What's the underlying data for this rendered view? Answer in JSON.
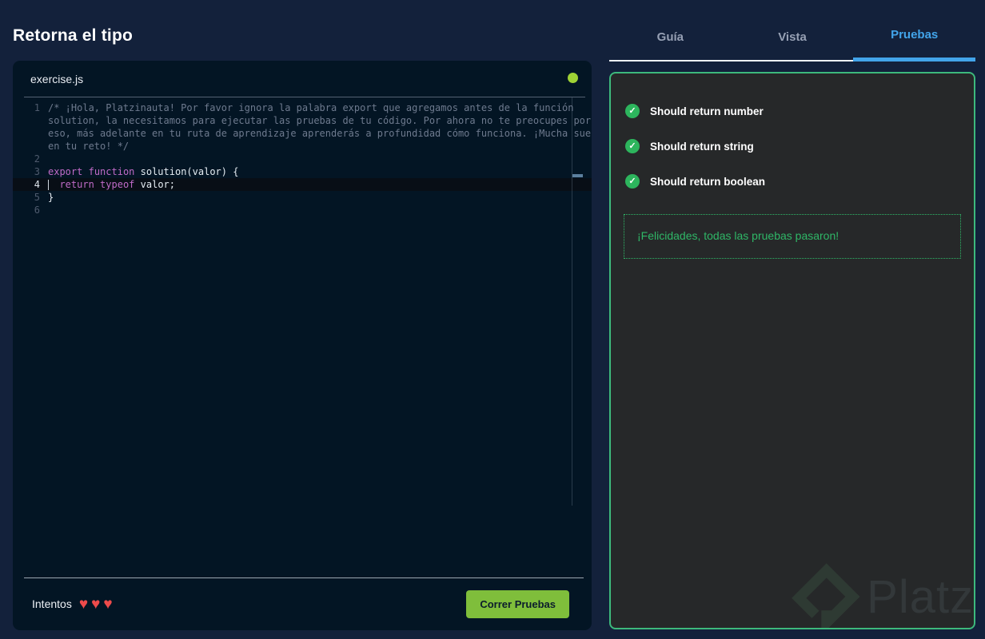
{
  "page": {
    "title": "Retorna el tipo"
  },
  "editor": {
    "filename": "exercise.js",
    "status_dot_color": "#9fd235",
    "rows": [
      {
        "gutter": "1",
        "tokens": [
          {
            "t": "/* ¡Hola, Platzinauta! Por favor ignora la palabra export que agregamos antes de la función",
            "c": "comment"
          }
        ]
      },
      {
        "gutter": "",
        "tokens": [
          {
            "t": "solution, la necesitamos para ejecutar las pruebas de tu código. Por ahora no te preocupes por",
            "c": "comment"
          }
        ]
      },
      {
        "gutter": "",
        "tokens": [
          {
            "t": "eso, más adelante en tu ruta de aprendizaje aprenderás a profundidad cómo funciona. ¡Mucha suerte",
            "c": "comment"
          }
        ]
      },
      {
        "gutter": "",
        "tokens": [
          {
            "t": "en tu reto! */",
            "c": "comment"
          }
        ]
      },
      {
        "gutter": "2",
        "tokens": []
      },
      {
        "gutter": "3",
        "tokens": [
          {
            "t": "export",
            "c": "keyword"
          },
          {
            "t": " ",
            "c": "plain"
          },
          {
            "t": "function",
            "c": "keyword"
          },
          {
            "t": " ",
            "c": "plain"
          },
          {
            "t": "solution(valor) {",
            "c": "plain"
          }
        ]
      },
      {
        "gutter": "4",
        "active": true,
        "cursor": true,
        "tokens": [
          {
            "t": "  ",
            "c": "plain"
          },
          {
            "t": "return",
            "c": "keyword"
          },
          {
            "t": " ",
            "c": "plain"
          },
          {
            "t": "typeof",
            "c": "keyword"
          },
          {
            "t": " ",
            "c": "plain"
          },
          {
            "t": "valor;",
            "c": "plain"
          }
        ]
      },
      {
        "gutter": "5",
        "tokens": [
          {
            "t": "}",
            "c": "plain"
          }
        ]
      },
      {
        "gutter": "6",
        "tokens": []
      }
    ],
    "footer": {
      "attempts_label": "Intentos",
      "hearts_count": 3,
      "heart_color": "#ee4b4b",
      "run_button_label": "Correr Pruebas",
      "run_button_color": "#7fbe3b"
    }
  },
  "tabs": [
    {
      "label": "Guía",
      "active": false
    },
    {
      "label": "Vista",
      "active": false
    },
    {
      "label": "Pruebas",
      "active": true
    }
  ],
  "tabs_accent_color": "#42a4ea",
  "tests": {
    "panel_border_color": "#3db97c",
    "check_color": "#2db55d",
    "items": [
      "Should return number",
      "Should return string",
      "Should return boolean"
    ],
    "success_message": "¡Felicidades, todas las pruebas pasaron!",
    "success_color": "#2fb767"
  },
  "watermark": {
    "brand": "Platzi"
  }
}
